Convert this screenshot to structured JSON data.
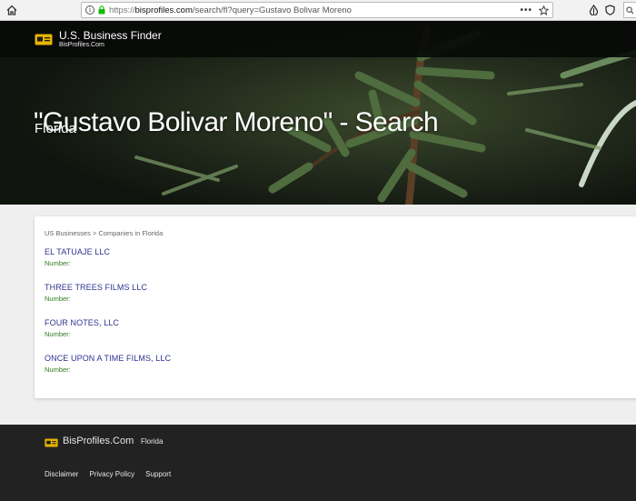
{
  "browser": {
    "url_protocol": "https://",
    "url_host": "bisprofiles.com",
    "url_path": "/search/fl?query=Gustavo Bolivar Moreno",
    "more_actions": "•••",
    "search_placeholder": "Search"
  },
  "header": {
    "brand_name": "U.S. Business Finder",
    "brand_sub": "BisProfiles.Com"
  },
  "hero": {
    "title": "\"Gustavo Bolivar Moreno\" - Search",
    "subtitle": "Florida"
  },
  "main": {
    "breadcrumb": "US Businesses > Companies in Florida",
    "number_label": "Number:",
    "results": [
      {
        "name": "EL TATUAJE LLC"
      },
      {
        "name": "THREE TREES FILMS LLC"
      },
      {
        "name": "FOUR NOTES, LLC"
      },
      {
        "name": "ONCE UPON A TIME FILMS, LLC"
      }
    ]
  },
  "footer": {
    "brand": "BisProfiles.Com",
    "state": "Florida",
    "links": [
      "Disclaimer",
      "Privacy Policy",
      "Support"
    ]
  },
  "colors": {
    "link": "#2e3192",
    "number_label": "#2f7a1f",
    "footer_bg": "#222222",
    "logo": "#e5b400"
  }
}
